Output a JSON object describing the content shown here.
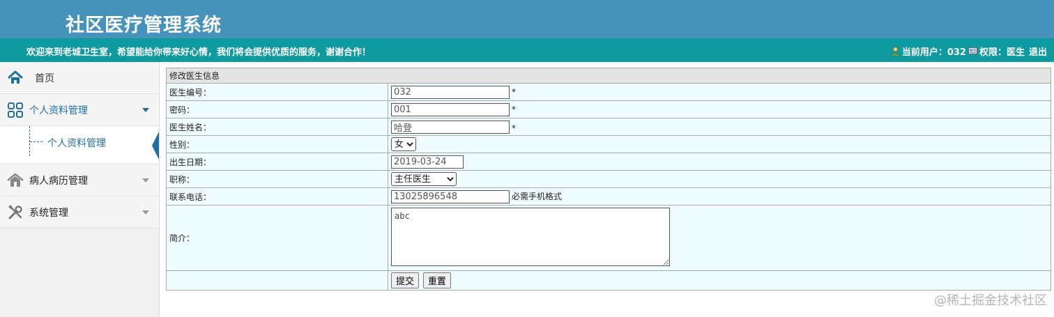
{
  "header": {
    "title": "社区医疗管理系统"
  },
  "welcome_bar": {
    "message": "欢迎来到老城卫生室，希望能给你带来好心情，我们将会提供优质的服务，谢谢合作！",
    "current_user_label": "当前用户：032",
    "permission_label": "权限：医生",
    "logout_label": "退出"
  },
  "sidebar": {
    "home": "首页",
    "personal": "个人资料管理",
    "personal_sub": "个人资料管理",
    "records": "病人病历管理",
    "system": "系统管理"
  },
  "form": {
    "heading": "修改医生信息",
    "id_label": "医生编号：",
    "id_value": "032",
    "password_label": "密码：",
    "password_value": "001",
    "name_label": "医生姓名：",
    "name_value": "哈登",
    "required_mark": "*",
    "gender_label": "性别：",
    "gender_value": "女",
    "birth_label": "出生日期：",
    "birth_value": "2019-03-24",
    "title_label": "职称：",
    "title_value": "主任医生",
    "phone_label": "联系电话：",
    "phone_value": "13025896548",
    "phone_hint": "必需手机格式",
    "intro_label": "简介：",
    "intro_value": "abc",
    "submit_label": "提交",
    "reset_label": "重置"
  },
  "watermark": "@稀土掘金技术社区",
  "colors": {
    "header_bg": "#4592bb",
    "welcome_bg": "#0f9aa0",
    "accent": "#1e6ea0",
    "form_row_bg": "#eefcfd"
  }
}
